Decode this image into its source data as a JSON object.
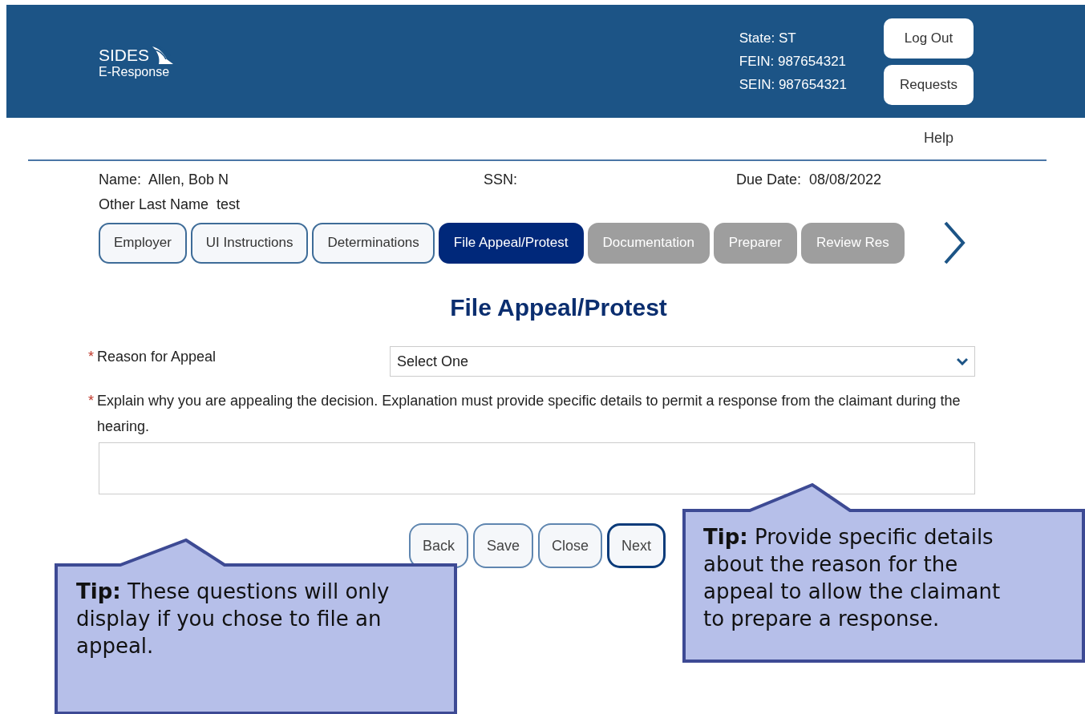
{
  "header": {
    "logo_title": "SIDES",
    "logo_subtitle": "E-Response",
    "state": "State: ST",
    "fein": "FEIN: 987654321",
    "sein": "SEIN: 987654321",
    "buttons": [
      "Log Out",
      "Requests"
    ]
  },
  "help_link": "Help",
  "claim": {
    "name_label": "Name:",
    "name": "Allen, Bob N",
    "ssn_label": "SSN:",
    "due_label": "Due Date:",
    "due": "08/08/2022",
    "other_label": "Other Last Name",
    "other": "test"
  },
  "tabs": [
    {
      "label": "Employer",
      "selected": false,
      "disabled": false
    },
    {
      "label": "UI Instructions",
      "selected": false,
      "disabled": false
    },
    {
      "label": "Determinations",
      "selected": false,
      "disabled": false
    },
    {
      "label": "File Appeal/Protest",
      "selected": true,
      "disabled": false
    },
    {
      "label": "Documentation",
      "selected": false,
      "disabled": true
    },
    {
      "label": "Preparer",
      "selected": false,
      "disabled": true
    },
    {
      "label": "Review Res",
      "selected": false,
      "disabled": true
    }
  ],
  "page_title": "File Appeal/Protest",
  "fields": [
    {
      "kind": "select",
      "required_mark": "*",
      "label": "Reason for Appeal",
      "value": "Select One"
    },
    {
      "kind": "textarea",
      "required_mark": "*",
      "label": "Explain why you are appealing the decision. Explanation must provide specific details to permit a response from the claimant during the hearing."
    }
  ],
  "buttons": [
    {
      "label": "Back",
      "primary": false
    },
    {
      "label": "Save",
      "primary": false
    },
    {
      "label": "Close",
      "primary": false
    },
    {
      "label": "Next",
      "primary": true
    }
  ],
  "tips": [
    {
      "text": "**Tip:** These questions will only display if you chose to file an appeal."
    },
    {
      "text": "**Tip:** Provide specific details about the reason for the appeal to allow the claimant to prepare a response."
    }
  ]
}
